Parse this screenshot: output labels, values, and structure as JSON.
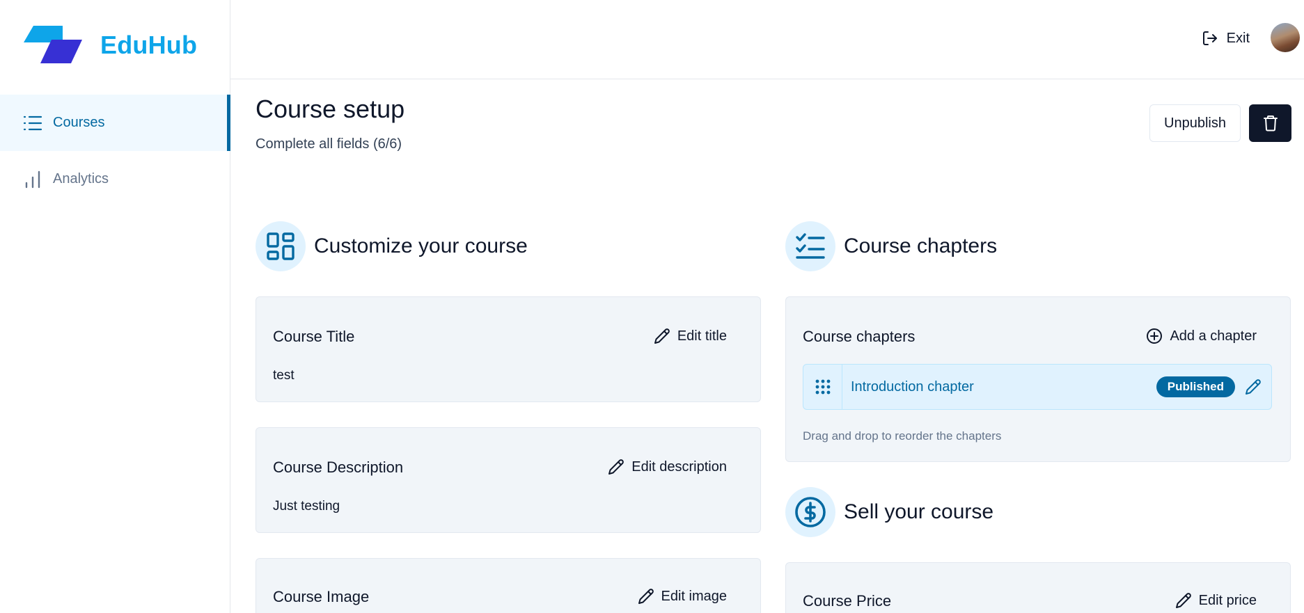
{
  "app": {
    "name": "EduHub"
  },
  "sidebar": {
    "items": [
      {
        "label": "Courses",
        "icon": "list-icon",
        "active": true
      },
      {
        "label": "Analytics",
        "icon": "bar-chart-icon",
        "active": false
      }
    ]
  },
  "topbar": {
    "exit_label": "Exit"
  },
  "header": {
    "title": "Course setup",
    "subtitle": "Complete all fields (6/6)",
    "unpublish_label": "Unpublish"
  },
  "customize": {
    "heading": "Customize your course",
    "title_card": {
      "label": "Course Title",
      "action": "Edit title",
      "value": "test"
    },
    "description_card": {
      "label": "Course Description",
      "action": "Edit description",
      "value": "Just testing"
    },
    "image_card": {
      "label": "Course Image",
      "action": "Edit image"
    }
  },
  "chapters": {
    "heading": "Course chapters",
    "card_label": "Course chapters",
    "add_label": "Add a chapter",
    "items": [
      {
        "title": "Introduction chapter",
        "status": "Published"
      }
    ],
    "hint": "Drag and drop to reorder the chapters"
  },
  "sell": {
    "heading": "Sell your course",
    "price_card": {
      "label": "Course Price",
      "action": "Edit price"
    }
  },
  "colors": {
    "brand": "#0ea5e9",
    "accent": "#0369a1",
    "dark": "#0f172a",
    "card_bg": "#f1f5f9"
  }
}
